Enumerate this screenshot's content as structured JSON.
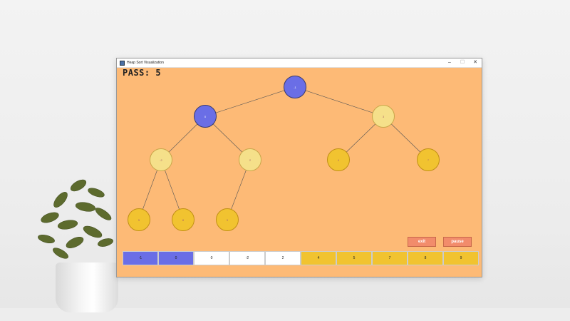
{
  "window": {
    "title": "Heap Sort Visualization",
    "controls": {
      "minimize": "–",
      "maximize": "☐",
      "close": "✕"
    }
  },
  "pass": {
    "text": "PASS: 5"
  },
  "tree": {
    "nodes": [
      {
        "id": "n0",
        "value": "-1",
        "state": "blue"
      },
      {
        "id": "n1",
        "value": "0",
        "state": "blue"
      },
      {
        "id": "n2",
        "value": "3",
        "state": "pale"
      },
      {
        "id": "n3",
        "value": "-2",
        "state": "pale"
      },
      {
        "id": "n4",
        "value": "2",
        "state": "pale"
      },
      {
        "id": "n5",
        "value": "4",
        "state": "gold"
      },
      {
        "id": "n6",
        "value": "7",
        "state": "gold"
      },
      {
        "id": "n7",
        "value": "5",
        "state": "gold"
      },
      {
        "id": "n8",
        "value": "8",
        "state": "gold"
      },
      {
        "id": "n9",
        "value": "9",
        "state": "gold"
      }
    ]
  },
  "buttons": {
    "exit": "exit",
    "pause": "pause"
  },
  "array": [
    {
      "value": "-1",
      "state": "blue"
    },
    {
      "value": "0",
      "state": "blue"
    },
    {
      "value": "0",
      "state": "white"
    },
    {
      "value": "-2",
      "state": "white"
    },
    {
      "value": "2",
      "state": "white"
    },
    {
      "value": "4",
      "state": "gold"
    },
    {
      "value": "5",
      "state": "gold"
    },
    {
      "value": "7",
      "state": "gold"
    },
    {
      "value": "8",
      "state": "gold"
    },
    {
      "value": "9",
      "state": "gold"
    }
  ],
  "colors": {
    "background": "#fdba76",
    "blue": "#6a6ee6",
    "pale": "#f5e08a",
    "gold": "#f1c330",
    "button": "#f28c6b"
  }
}
